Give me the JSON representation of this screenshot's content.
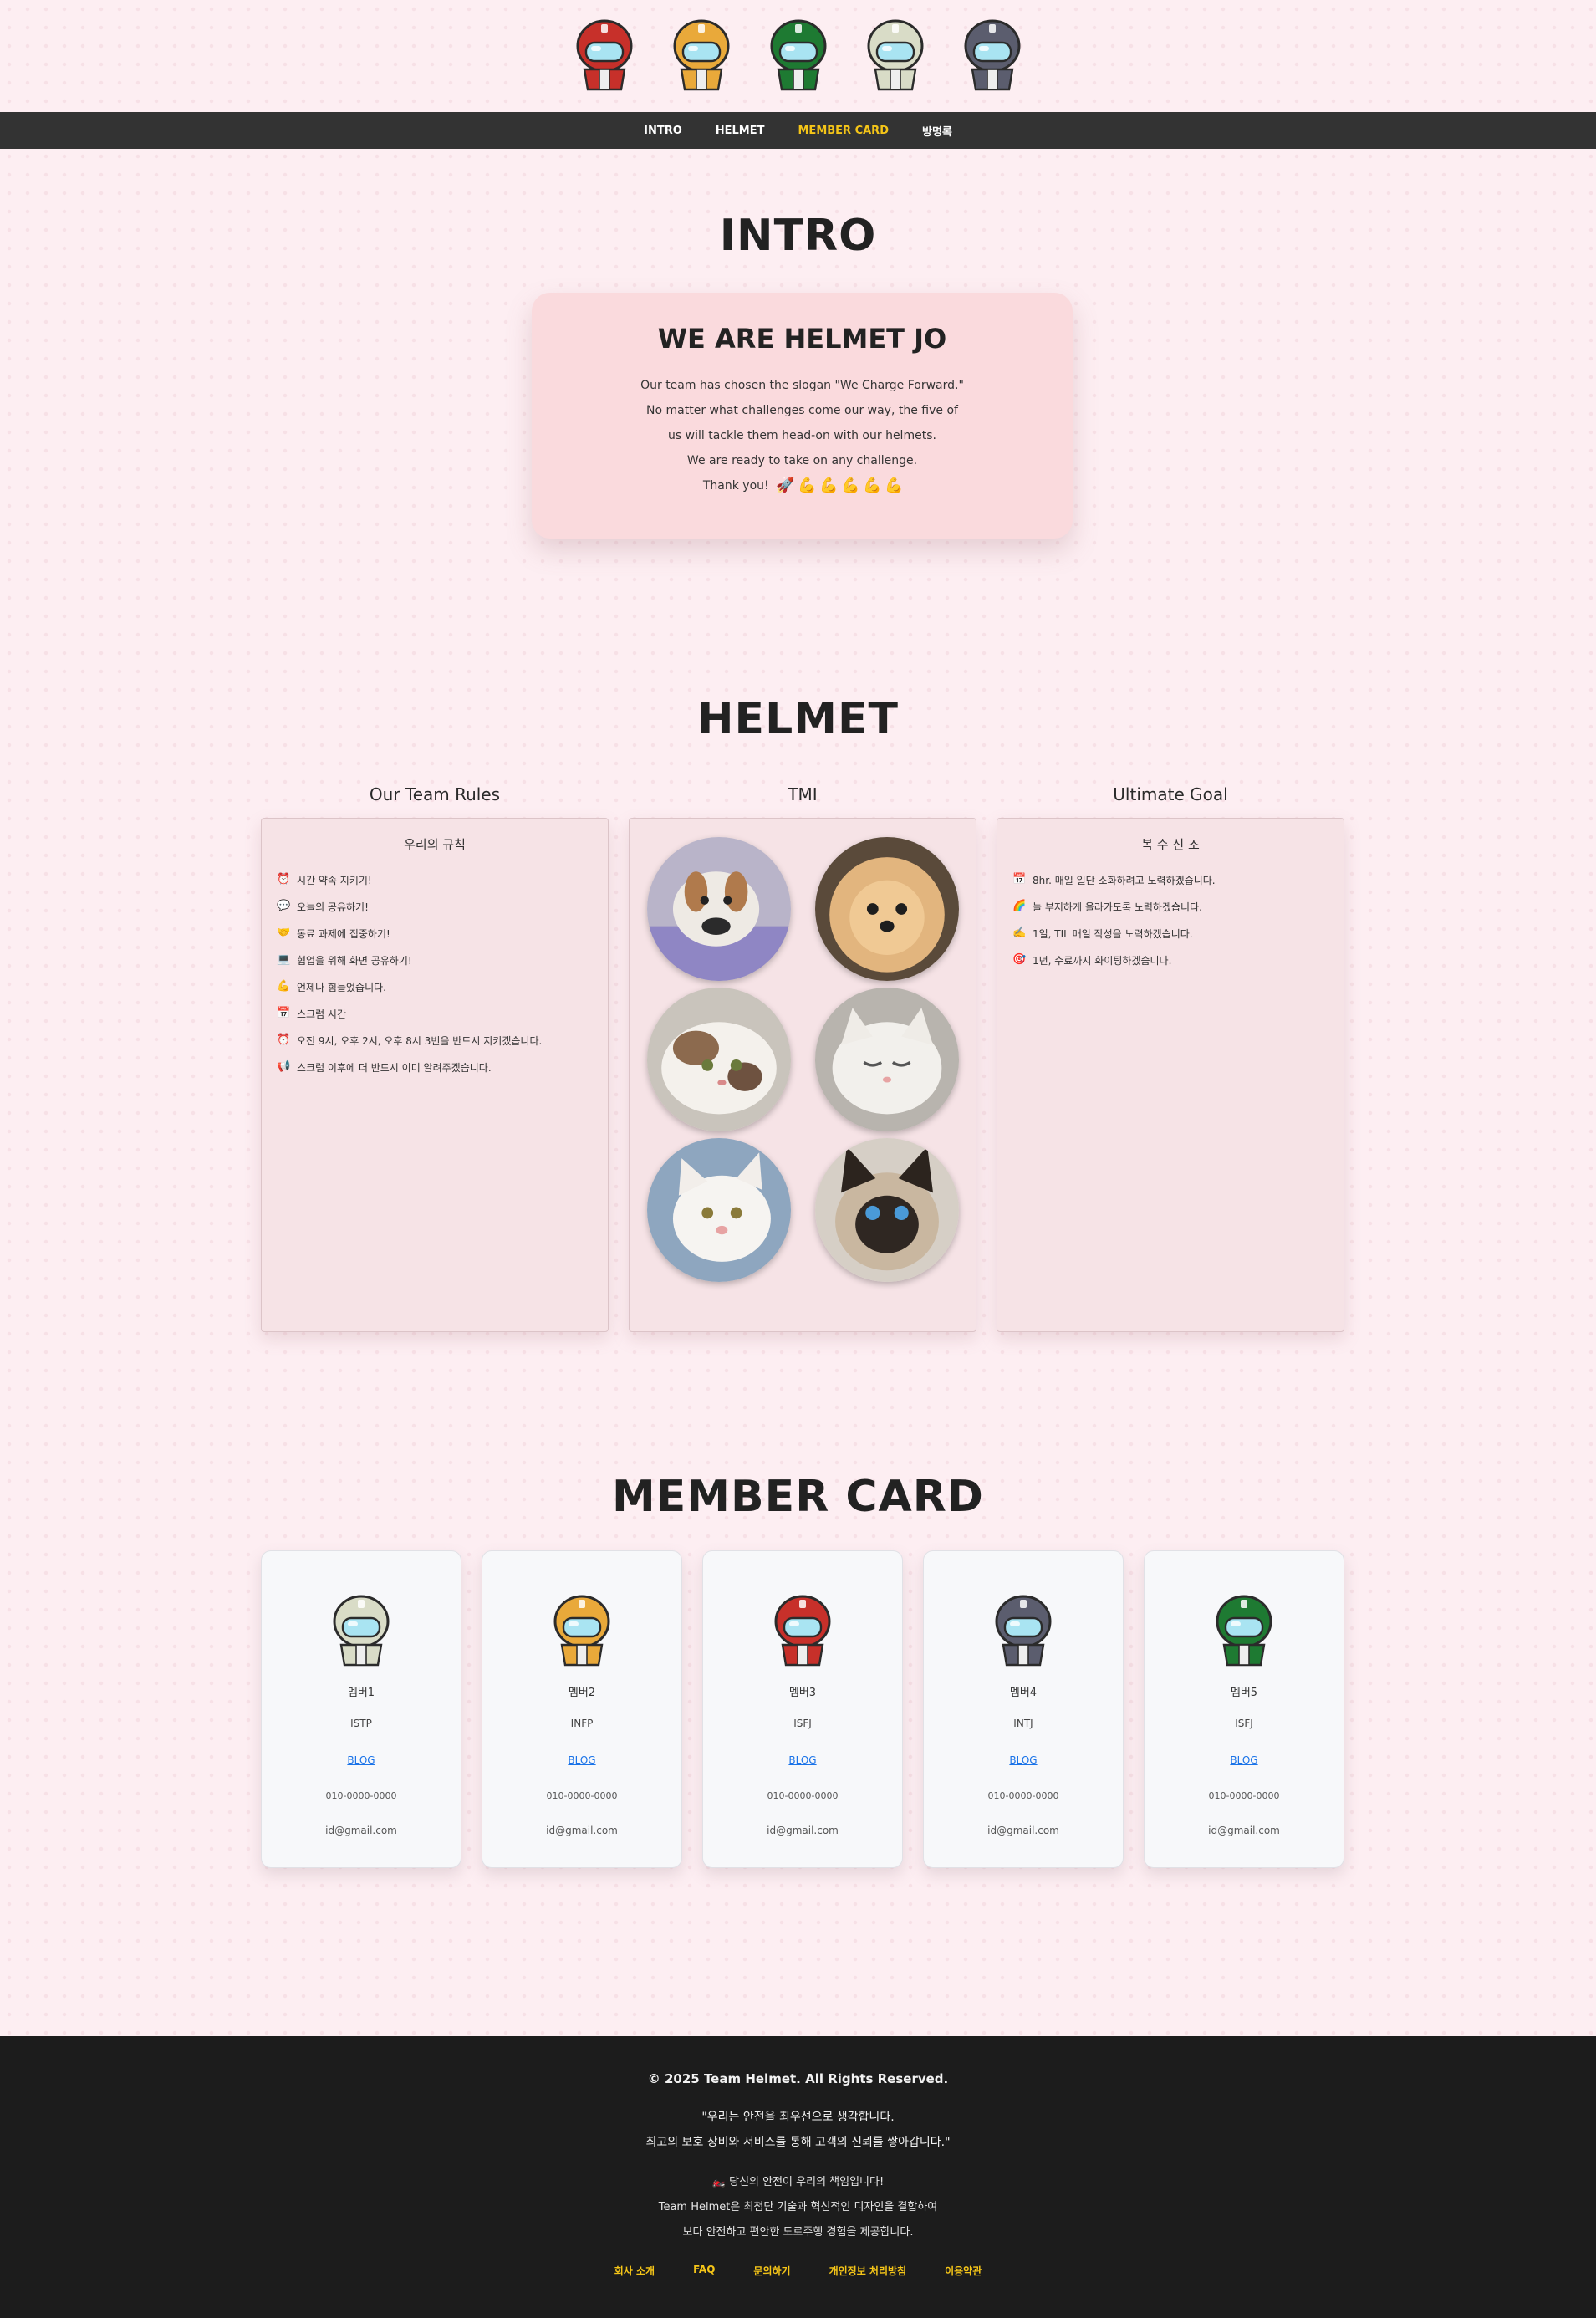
{
  "header": {
    "helmets": [
      {
        "name": "red-helmet",
        "color": "#c7302a"
      },
      {
        "name": "yellow-helmet",
        "color": "#e9a93a"
      },
      {
        "name": "green-helmet",
        "color": "#1e7a32"
      },
      {
        "name": "cream-helmet",
        "color": "#d9dcc7"
      },
      {
        "name": "slate-helmet",
        "color": "#5b5d6e"
      }
    ]
  },
  "nav": {
    "items": [
      {
        "label": "INTRO",
        "active": false
      },
      {
        "label": "HELMET",
        "active": false
      },
      {
        "label": "MEMBER CARD",
        "active": true
      },
      {
        "label": "방명록",
        "active": false
      }
    ]
  },
  "intro": {
    "title": "INTRO",
    "card_heading": "WE ARE HELMET JO",
    "lines": [
      "Our team has chosen the slogan \"We Charge Forward.\"",
      "No matter what challenges come our way, the five of",
      "us will tackle them head-on with our helmets.",
      "We are ready to take on any challenge.",
      "Thank you!"
    ],
    "emojis": [
      "🚀",
      "💪",
      "💪",
      "💪",
      "💪",
      "💪"
    ]
  },
  "helmet_section": {
    "title": "HELMET",
    "rules": {
      "column_title": "Our Team Rules",
      "heading": "우리의 규칙",
      "items": [
        {
          "icon": "⏰",
          "text": "시간 약속 지키기!"
        },
        {
          "icon": "💬",
          "text": "오늘의 공유하기!"
        },
        {
          "icon": "🤝",
          "text": "동료 과제에 집중하기!"
        },
        {
          "icon": "💻",
          "text": "협업을 위해 화면 공유하기!"
        },
        {
          "icon": "💪",
          "text": "언제나 힘들었습니다."
        },
        {
          "icon": "📅",
          "text": "스크럼 시간"
        },
        {
          "icon": "⏰",
          "text": "오전 9시, 오후 2시, 오후 8시 3번을 반드시 지키겠습니다."
        },
        {
          "icon": "📢",
          "text": "스크럼 이후에 더 반드시 이미 알려주겠습니다."
        }
      ]
    },
    "tmi": {
      "column_title": "TMI",
      "photos": [
        {
          "name": "dog-photo-1",
          "alt": "dog"
        },
        {
          "name": "dog-photo-2",
          "alt": "pomeranian"
        },
        {
          "name": "cat-photo-1",
          "alt": "calico cat"
        },
        {
          "name": "cat-photo-2",
          "alt": "white cat"
        },
        {
          "name": "cat-photo-3",
          "alt": "white kitten"
        },
        {
          "name": "cat-photo-4",
          "alt": "siamese cat"
        }
      ]
    },
    "goal": {
      "column_title": "Ultimate Goal",
      "heading": "복 수 신 조",
      "items": [
        {
          "icon": "📅",
          "text": "8hr. 매일 일단 소화하려고 노력하겠습니다."
        },
        {
          "icon": "🌈",
          "text": "늘 부지하게 올라가도록 노력하겠습니다."
        },
        {
          "icon": "✍️",
          "text": "1일, TIL 매일 작성을 노력하겠습니다."
        },
        {
          "icon": "🎯",
          "text": "1년, 수료까지 화이팅하겠습니다."
        }
      ]
    }
  },
  "members": {
    "title": "MEMBER CARD",
    "cards": [
      {
        "helmet": "cream-helmet",
        "name": "멤버1",
        "mbti": "ISTP",
        "blog": "BLOG",
        "phone": "010-0000-0000",
        "email": "id@gmail.com",
        "color": "#d9dcc7"
      },
      {
        "helmet": "yellow-helmet",
        "name": "멤버2",
        "mbti": "INFP",
        "blog": "BLOG",
        "phone": "010-0000-0000",
        "email": "id@gmail.com",
        "color": "#e9a93a"
      },
      {
        "helmet": "red-helmet",
        "name": "멤버3",
        "mbti": "ISFJ",
        "blog": "BLOG",
        "phone": "010-0000-0000",
        "email": "id@gmail.com",
        "color": "#c7302a"
      },
      {
        "helmet": "slate-helmet",
        "name": "멤버4",
        "mbti": "INTJ",
        "blog": "BLOG",
        "phone": "010-0000-0000",
        "email": "id@gmail.com",
        "color": "#5b5d6e"
      },
      {
        "helmet": "green-helmet",
        "name": "멤버5",
        "mbti": "ISFJ",
        "blog": "BLOG",
        "phone": "010-0000-0000",
        "email": "id@gmail.com",
        "color": "#1e7a32"
      }
    ]
  },
  "footer": {
    "copyright": "© 2025 Team Helmet. All Rights Reserved.",
    "quote_1": "\"우리는 안전을 최우선으로 생각합니다.",
    "quote_2": "최고의 보호 장비와 서비스를 통해 고객의 신뢰를 쌓아갑니다.\"",
    "mission_icon": "🏍️",
    "mission_1": "당신의 안전이 우리의 책임입니다!",
    "mission_2": "Team Helmet은 최첨단 기술과 혁신적인 디자인을 결합하여",
    "mission_3": "보다 안전하고 편안한 도로주행 경험을 제공합니다.",
    "links": [
      "회사 소개",
      "FAQ",
      "문의하기",
      "개인정보 처리방침",
      "이용약관"
    ]
  },
  "colors": {
    "background": "#fdeef2",
    "nav_bg": "#333333",
    "nav_active": "#f5c518",
    "intro_card": "#fadadd",
    "panel_bg": "#f6e3e6",
    "footer_bg": "#1c1c1c",
    "link_blue": "#1a73e8"
  }
}
